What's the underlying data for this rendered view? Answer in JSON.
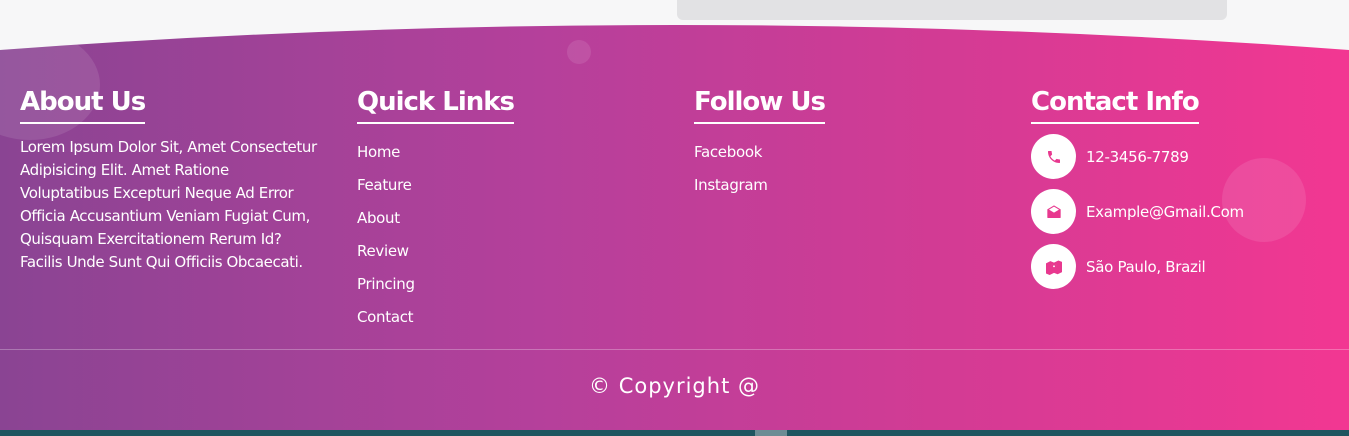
{
  "footer": {
    "about": {
      "heading": "About Us",
      "text": "Lorem Ipsum Dolor Sit, Amet Consectetur Adipisicing Elit. Amet Ratione Voluptatibus Excepturi Neque Ad Error Officia Accusantium Veniam Fugiat Cum, Quisquam Exercitationem Rerum Id? Facilis Unde Sunt Qui Officiis Obcaecati."
    },
    "quick_links": {
      "heading": "Quick Links",
      "items": [
        "Home",
        "Feature",
        "About",
        "Review",
        "Princing",
        "Contact"
      ]
    },
    "follow": {
      "heading": "Follow Us",
      "items": [
        "Facebook",
        "Instagram"
      ]
    },
    "contact": {
      "heading": "Contact Info",
      "items": [
        {
          "icon": "phone-icon",
          "text": "12-3456-7789"
        },
        {
          "icon": "envelope-open-icon",
          "text": "Example@Gmail.Com"
        },
        {
          "icon": "map-marker-icon",
          "text": "São Paulo, Brazil"
        }
      ]
    },
    "copyright": "© Copyright @"
  },
  "colors": {
    "gradient_start": "#8a4493",
    "gradient_end": "#f23792",
    "icon_color": "#e8388f",
    "bottom_bar": "#1e5560"
  }
}
